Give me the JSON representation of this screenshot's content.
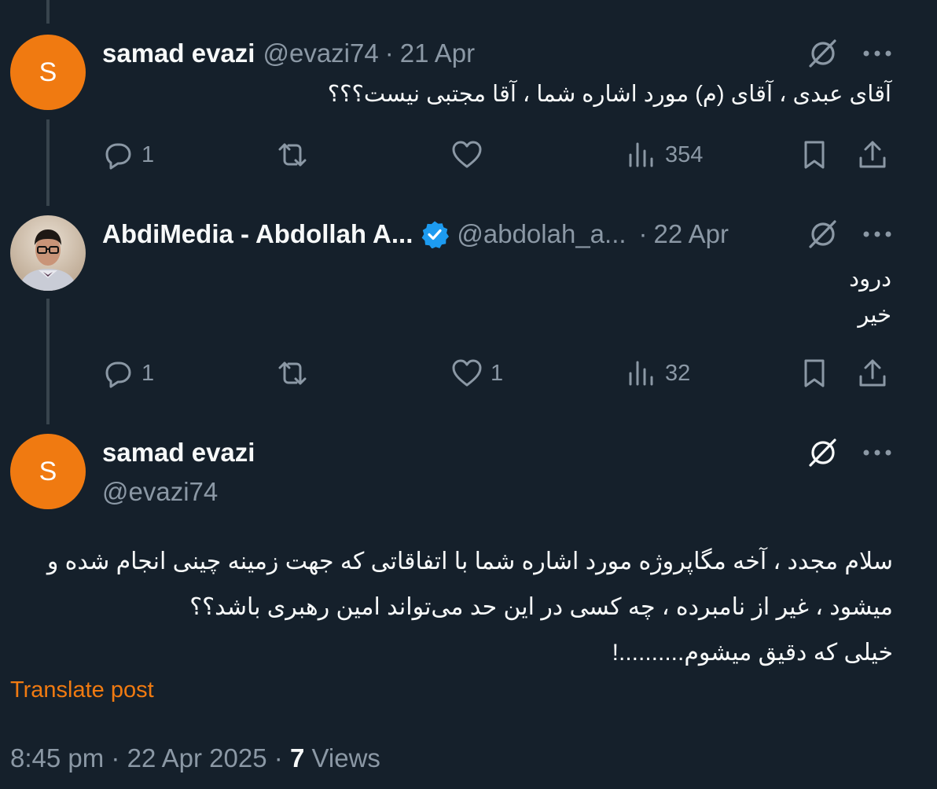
{
  "tweets": [
    {
      "name": "samad evazi",
      "handle": "@evazi74",
      "separator": "·",
      "date": "21 Apr",
      "avatar_letter": "S",
      "text": "آقای عبدی ، آقای (م) مورد اشاره شما ، آقا مجتبی نیست؟؟؟",
      "replies": "1",
      "reposts": "",
      "likes": "",
      "views": "354"
    },
    {
      "name": "AbdiMedia - Abdollah A...",
      "handle": "@abdolah_a...",
      "separator": "·",
      "date": "22 Apr",
      "verified": true,
      "text_lines": [
        "درود",
        "خیر"
      ],
      "replies": "1",
      "reposts": "",
      "likes": "1",
      "views": "32"
    }
  ],
  "main_tweet": {
    "name": "samad evazi",
    "handle": "@evazi74",
    "avatar_letter": "S",
    "text_lines": [
      "سلام مجدد ، آخه مگاپروژه مورد اشاره شما با اتفاقاتی که جهت زمینه چینی انجام شده و",
      "میشود ، غیر از نامبرده ، چه کسی در این حد می‌تواند امین رهبری باشد؟؟",
      "خیلی که دقیق میشوم..........!"
    ],
    "translate_label": "Translate post",
    "time": "8:45 pm",
    "separator": "·",
    "date": "22 Apr 2025",
    "views_count": "7",
    "views_label": "Views"
  },
  "colors": {
    "background": "#15202b",
    "text": "#f7f9f9",
    "muted": "#8b98a5",
    "accent": "#f07a11",
    "verified": "#1d9bf0",
    "thread_line": "#38444d"
  },
  "icons": {
    "grok": "grok-icon",
    "more": "more-dots-icon",
    "reply": "reply-icon",
    "repost": "repost-icon",
    "like": "heart-icon",
    "views": "views-icon",
    "bookmark": "bookmark-icon",
    "share": "share-icon"
  }
}
